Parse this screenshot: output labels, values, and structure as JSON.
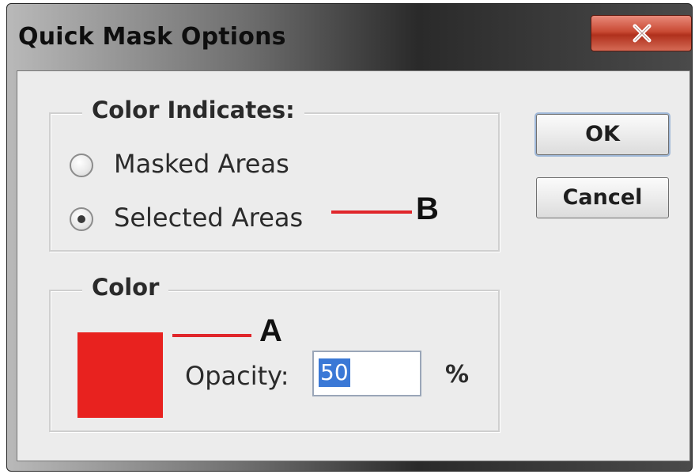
{
  "dialog": {
    "title": "Quick Mask Options",
    "close_icon": "close-x-icon",
    "color_indicates": {
      "legend": "Color Indicates:",
      "options": [
        {
          "label": "Masked Areas",
          "selected": false
        },
        {
          "label": "Selected Areas",
          "selected": true
        }
      ]
    },
    "color": {
      "legend": "Color",
      "swatch_color": "#e8221f",
      "opacity_label": "Opacity:",
      "opacity_value": "50",
      "opacity_unit": "%"
    },
    "buttons": {
      "ok": "OK",
      "cancel": "Cancel"
    }
  },
  "annotations": {
    "a_letter": "A",
    "b_letter": "B",
    "line_color": "#e0262b"
  }
}
